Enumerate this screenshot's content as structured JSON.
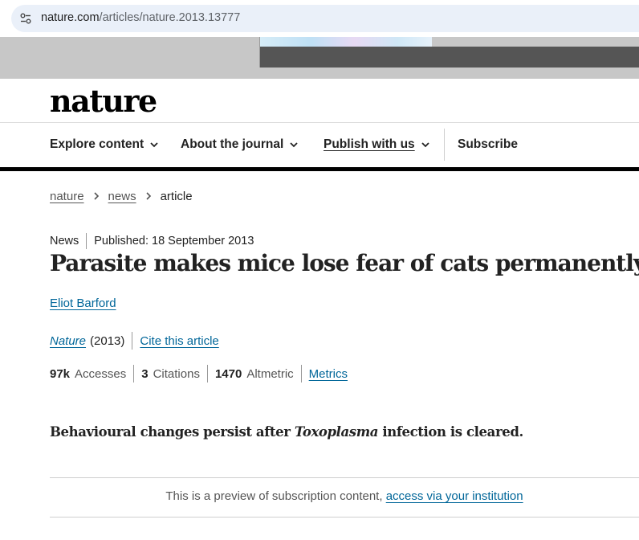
{
  "browser": {
    "url_domain": "nature.com",
    "url_path": "/articles/nature.2013.13777"
  },
  "site": {
    "logo": "nature"
  },
  "nav": {
    "explore": "Explore content",
    "about": "About the journal",
    "publish": "Publish with us",
    "subscribe": "Subscribe"
  },
  "breadcrumb": {
    "root": "nature",
    "section": "news",
    "current": "article"
  },
  "article": {
    "type": "News",
    "published": "Published: 18 September 2013",
    "title": "Parasite makes mice lose fear of cats permanently",
    "author": "Eliot Barford",
    "journal": "Nature",
    "year": "(2013)",
    "cite_label": "Cite this article",
    "standfirst_before": "Behavioural changes persist after ",
    "standfirst_italic": "Toxoplasma",
    "standfirst_after": " infection is cleared."
  },
  "metrics": {
    "accesses_value": "97k",
    "accesses_label": "Accesses",
    "citations_value": "3",
    "citations_label": "Citations",
    "altmetric_value": "1470",
    "altmetric_label": "Altmetric",
    "metrics_link": "Metrics"
  },
  "preview": {
    "text": "This is a preview of subscription content, ",
    "link": "access via your institution"
  },
  "colors": {
    "link": "#006699",
    "text": "#222222",
    "url_bar": "#eaf0f9"
  }
}
